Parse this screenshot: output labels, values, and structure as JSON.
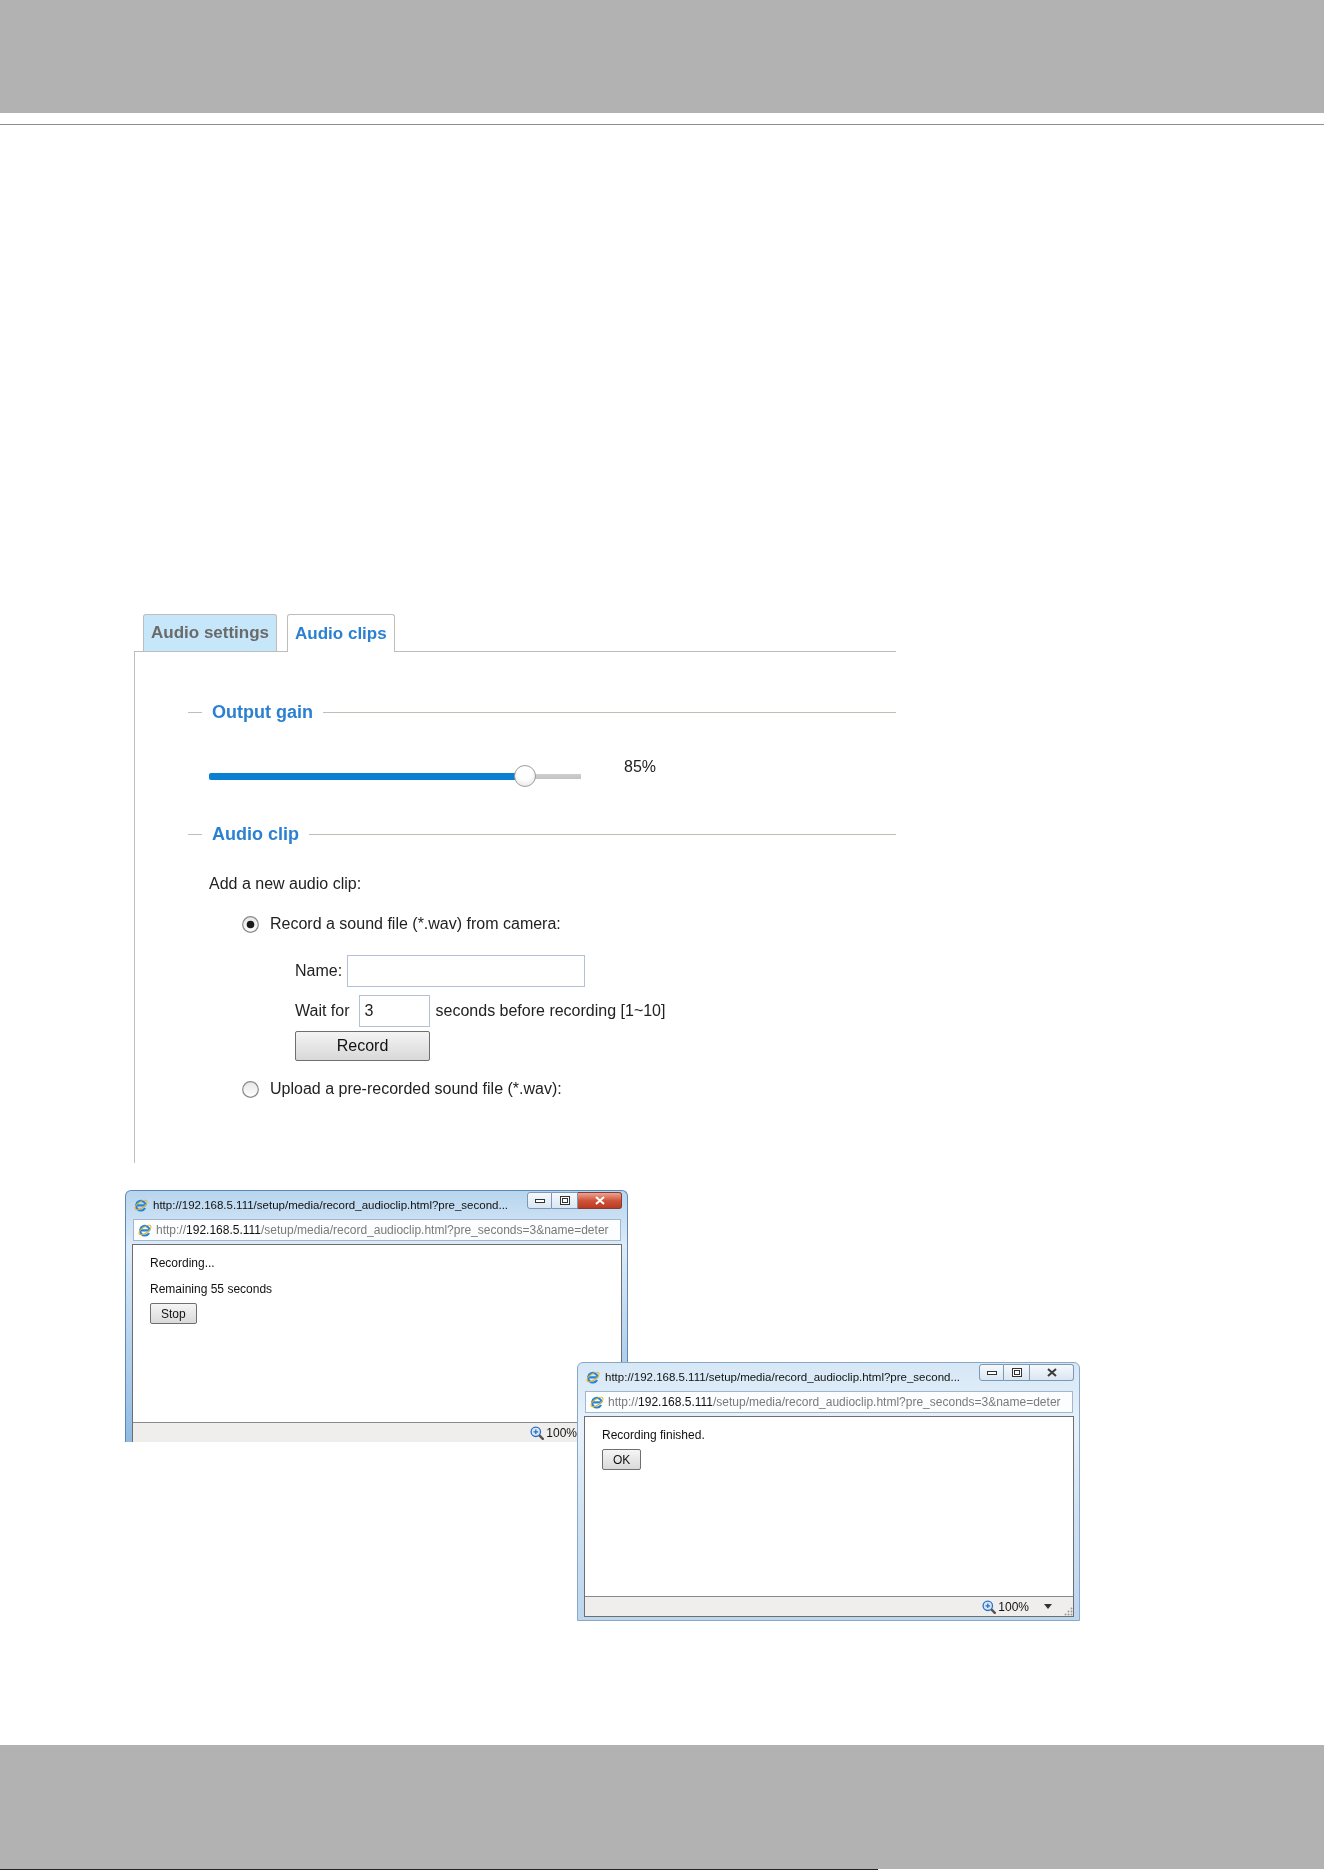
{
  "tabs": [
    {
      "label": "Audio settings",
      "selected": false
    },
    {
      "label": "Audio clips",
      "selected": true
    }
  ],
  "output_gain": {
    "title": "Output gain",
    "level": 0.85,
    "reading": "85%"
  },
  "audio_clip": {
    "title": "Audio clip",
    "intro": "Add a new audio clip:",
    "options": [
      {
        "label": "Record a sound file (*.wav) from camera:",
        "selected": true,
        "form": {
          "name_label": "Name:",
          "wait_label": "Wait for",
          "wait_value": "3",
          "wait_hint": "seconds before recording [1~10]",
          "button": "Record"
        }
      },
      {
        "label": "Upload a pre-recorded sound file (*.wav):",
        "selected": false
      }
    ]
  },
  "popups": [
    {
      "active": true,
      "title": "http://192.168.5.111/setup/media/record_audioclip.html?pre_second...",
      "address": {
        "scheme": "http://",
        "host": "192.168.5.111",
        "path": "/setup/media/record_audioclip.html?pre_seconds=3&name=deter"
      },
      "lines": [
        "Recording...",
        "Remaining 55 seconds"
      ],
      "button": "Stop",
      "zoom": "100%"
    },
    {
      "active": false,
      "title": "http://192.168.5.111/setup/media/record_audioclip.html?pre_second...",
      "address": {
        "scheme": "http://",
        "host": "192.168.5.111",
        "path": "/setup/media/record_audioclip.html?pre_seconds=3&name=deter"
      },
      "lines": [
        "Recording finished."
      ],
      "button": "OK",
      "zoom": "100%",
      "zoom_menu": true
    }
  ]
}
